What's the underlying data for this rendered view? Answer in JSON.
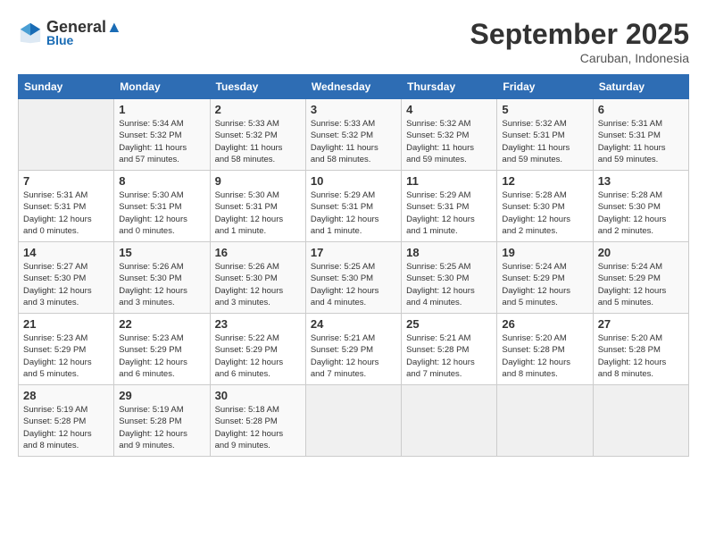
{
  "header": {
    "logo_line1": "General",
    "logo_line2": "Blue",
    "month": "September 2025",
    "location": "Caruban, Indonesia"
  },
  "days_of_week": [
    "Sunday",
    "Monday",
    "Tuesday",
    "Wednesday",
    "Thursday",
    "Friday",
    "Saturday"
  ],
  "weeks": [
    [
      {
        "day": "",
        "info": ""
      },
      {
        "day": "1",
        "info": "Sunrise: 5:34 AM\nSunset: 5:32 PM\nDaylight: 11 hours\nand 57 minutes."
      },
      {
        "day": "2",
        "info": "Sunrise: 5:33 AM\nSunset: 5:32 PM\nDaylight: 11 hours\nand 58 minutes."
      },
      {
        "day": "3",
        "info": "Sunrise: 5:33 AM\nSunset: 5:32 PM\nDaylight: 11 hours\nand 58 minutes."
      },
      {
        "day": "4",
        "info": "Sunrise: 5:32 AM\nSunset: 5:32 PM\nDaylight: 11 hours\nand 59 minutes."
      },
      {
        "day": "5",
        "info": "Sunrise: 5:32 AM\nSunset: 5:31 PM\nDaylight: 11 hours\nand 59 minutes."
      },
      {
        "day": "6",
        "info": "Sunrise: 5:31 AM\nSunset: 5:31 PM\nDaylight: 11 hours\nand 59 minutes."
      }
    ],
    [
      {
        "day": "7",
        "info": "Sunrise: 5:31 AM\nSunset: 5:31 PM\nDaylight: 12 hours\nand 0 minutes."
      },
      {
        "day": "8",
        "info": "Sunrise: 5:30 AM\nSunset: 5:31 PM\nDaylight: 12 hours\nand 0 minutes."
      },
      {
        "day": "9",
        "info": "Sunrise: 5:30 AM\nSunset: 5:31 PM\nDaylight: 12 hours\nand 1 minute."
      },
      {
        "day": "10",
        "info": "Sunrise: 5:29 AM\nSunset: 5:31 PM\nDaylight: 12 hours\nand 1 minute."
      },
      {
        "day": "11",
        "info": "Sunrise: 5:29 AM\nSunset: 5:31 PM\nDaylight: 12 hours\nand 1 minute."
      },
      {
        "day": "12",
        "info": "Sunrise: 5:28 AM\nSunset: 5:30 PM\nDaylight: 12 hours\nand 2 minutes."
      },
      {
        "day": "13",
        "info": "Sunrise: 5:28 AM\nSunset: 5:30 PM\nDaylight: 12 hours\nand 2 minutes."
      }
    ],
    [
      {
        "day": "14",
        "info": "Sunrise: 5:27 AM\nSunset: 5:30 PM\nDaylight: 12 hours\nand 3 minutes."
      },
      {
        "day": "15",
        "info": "Sunrise: 5:26 AM\nSunset: 5:30 PM\nDaylight: 12 hours\nand 3 minutes."
      },
      {
        "day": "16",
        "info": "Sunrise: 5:26 AM\nSunset: 5:30 PM\nDaylight: 12 hours\nand 3 minutes."
      },
      {
        "day": "17",
        "info": "Sunrise: 5:25 AM\nSunset: 5:30 PM\nDaylight: 12 hours\nand 4 minutes."
      },
      {
        "day": "18",
        "info": "Sunrise: 5:25 AM\nSunset: 5:30 PM\nDaylight: 12 hours\nand 4 minutes."
      },
      {
        "day": "19",
        "info": "Sunrise: 5:24 AM\nSunset: 5:29 PM\nDaylight: 12 hours\nand 5 minutes."
      },
      {
        "day": "20",
        "info": "Sunrise: 5:24 AM\nSunset: 5:29 PM\nDaylight: 12 hours\nand 5 minutes."
      }
    ],
    [
      {
        "day": "21",
        "info": "Sunrise: 5:23 AM\nSunset: 5:29 PM\nDaylight: 12 hours\nand 5 minutes."
      },
      {
        "day": "22",
        "info": "Sunrise: 5:23 AM\nSunset: 5:29 PM\nDaylight: 12 hours\nand 6 minutes."
      },
      {
        "day": "23",
        "info": "Sunrise: 5:22 AM\nSunset: 5:29 PM\nDaylight: 12 hours\nand 6 minutes."
      },
      {
        "day": "24",
        "info": "Sunrise: 5:21 AM\nSunset: 5:29 PM\nDaylight: 12 hours\nand 7 minutes."
      },
      {
        "day": "25",
        "info": "Sunrise: 5:21 AM\nSunset: 5:28 PM\nDaylight: 12 hours\nand 7 minutes."
      },
      {
        "day": "26",
        "info": "Sunrise: 5:20 AM\nSunset: 5:28 PM\nDaylight: 12 hours\nand 8 minutes."
      },
      {
        "day": "27",
        "info": "Sunrise: 5:20 AM\nSunset: 5:28 PM\nDaylight: 12 hours\nand 8 minutes."
      }
    ],
    [
      {
        "day": "28",
        "info": "Sunrise: 5:19 AM\nSunset: 5:28 PM\nDaylight: 12 hours\nand 8 minutes."
      },
      {
        "day": "29",
        "info": "Sunrise: 5:19 AM\nSunset: 5:28 PM\nDaylight: 12 hours\nand 9 minutes."
      },
      {
        "day": "30",
        "info": "Sunrise: 5:18 AM\nSunset: 5:28 PM\nDaylight: 12 hours\nand 9 minutes."
      },
      {
        "day": "",
        "info": ""
      },
      {
        "day": "",
        "info": ""
      },
      {
        "day": "",
        "info": ""
      },
      {
        "day": "",
        "info": ""
      }
    ]
  ]
}
